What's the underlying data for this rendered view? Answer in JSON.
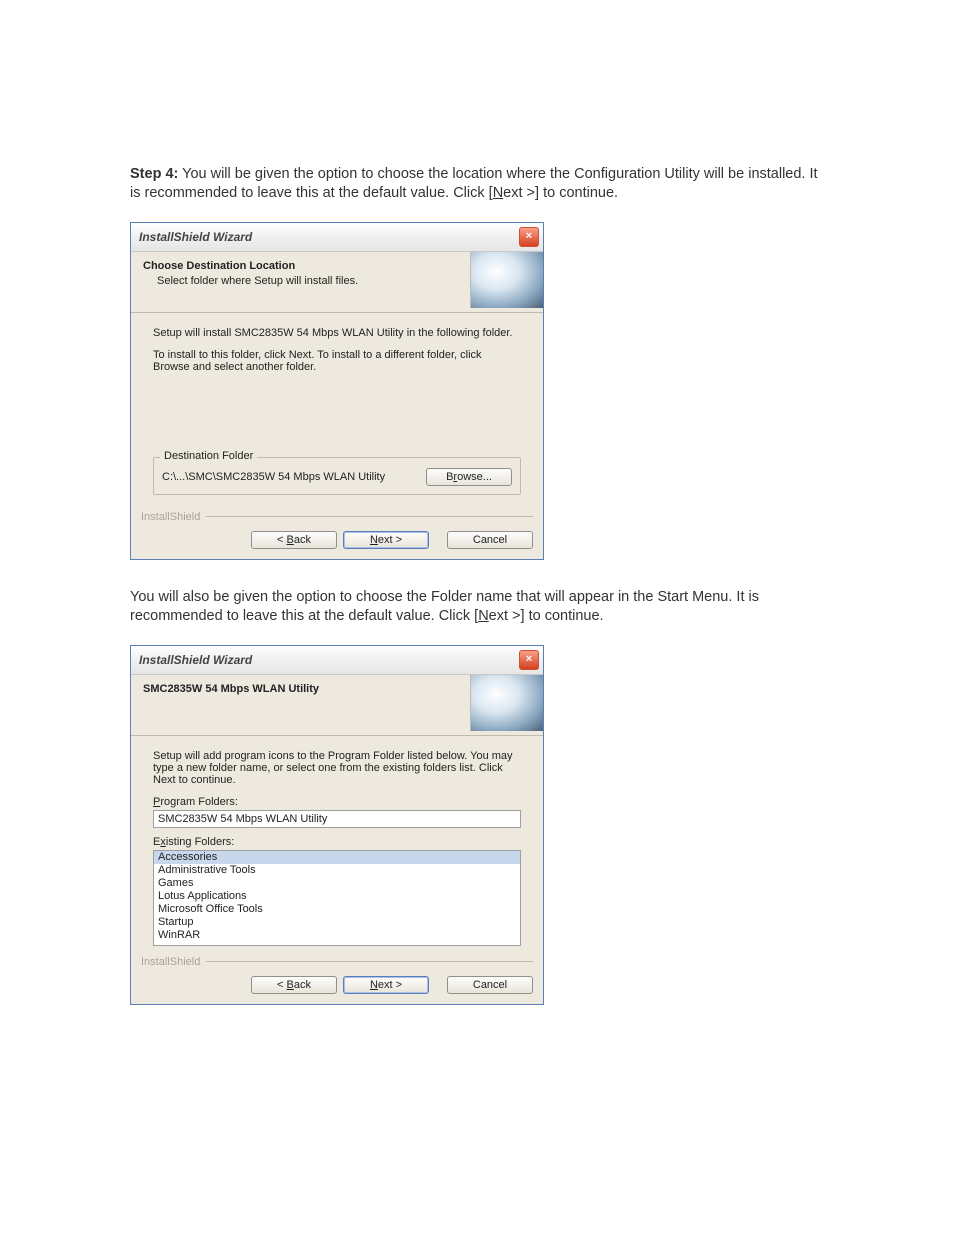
{
  "doc": {
    "step_label": "Step 4:",
    "para1_a": " You will be given the option to choose the location where the Configuration Utility will be installed. It is recommended to leave this at the default value. Click [",
    "para1_next_u": "N",
    "para1_next_rest": "ext >] to continue.",
    "para2_a": "You will also be given the option to choose the Folder name that will appear in the Start Menu. It is recommended to leave this at the default value. Click [",
    "para2_next_u": "N",
    "para2_next_rest": "ext >] to continue."
  },
  "dialog1": {
    "title": "InstallShield Wizard",
    "close": "×",
    "header_title": "Choose Destination Location",
    "header_sub": "Select folder where Setup will install files.",
    "line1": "Setup will install SMC2835W 54 Mbps WLAN Utility in the following folder.",
    "line2": "To install to this folder, click Next. To install to a different folder, click Browse and select another folder.",
    "fieldset_legend": "Destination Folder",
    "folder_path": "C:\\...\\SMC\\SMC2835W 54 Mbps WLAN Utility",
    "browse_u": "r",
    "browse_pre": "B",
    "browse_post": "owse...",
    "brand": "InstallShield",
    "back_pre": "< ",
    "back_u": "B",
    "back_post": "ack",
    "next_u": "N",
    "next_post": "ext >",
    "cancel": "Cancel"
  },
  "dialog2": {
    "title": "InstallShield Wizard",
    "close": "×",
    "header_title": "SMC2835W 54 Mbps WLAN Utility",
    "line1": "Setup will add program icons to the Program Folder listed below.  You may type a new folder name, or select one from the existing folders list.  Click Next to continue.",
    "prog_label_u": "P",
    "prog_label_post": "rogram Folders:",
    "prog_value": "SMC2835W 54 Mbps WLAN Utility",
    "exist_label_pre": "E",
    "exist_label_u": "x",
    "exist_label_post": "isting Folders:",
    "folders": {
      "f0": "Accessories",
      "f1": "Administrative Tools",
      "f2": "Games",
      "f3": "Lotus Applications",
      "f4": "Microsoft Office Tools",
      "f5": "Startup",
      "f6": "WinRAR"
    },
    "brand": "InstallShield",
    "back_pre": "< ",
    "back_u": "B",
    "back_post": "ack",
    "next_u": "N",
    "next_post": "ext >",
    "cancel": "Cancel"
  }
}
